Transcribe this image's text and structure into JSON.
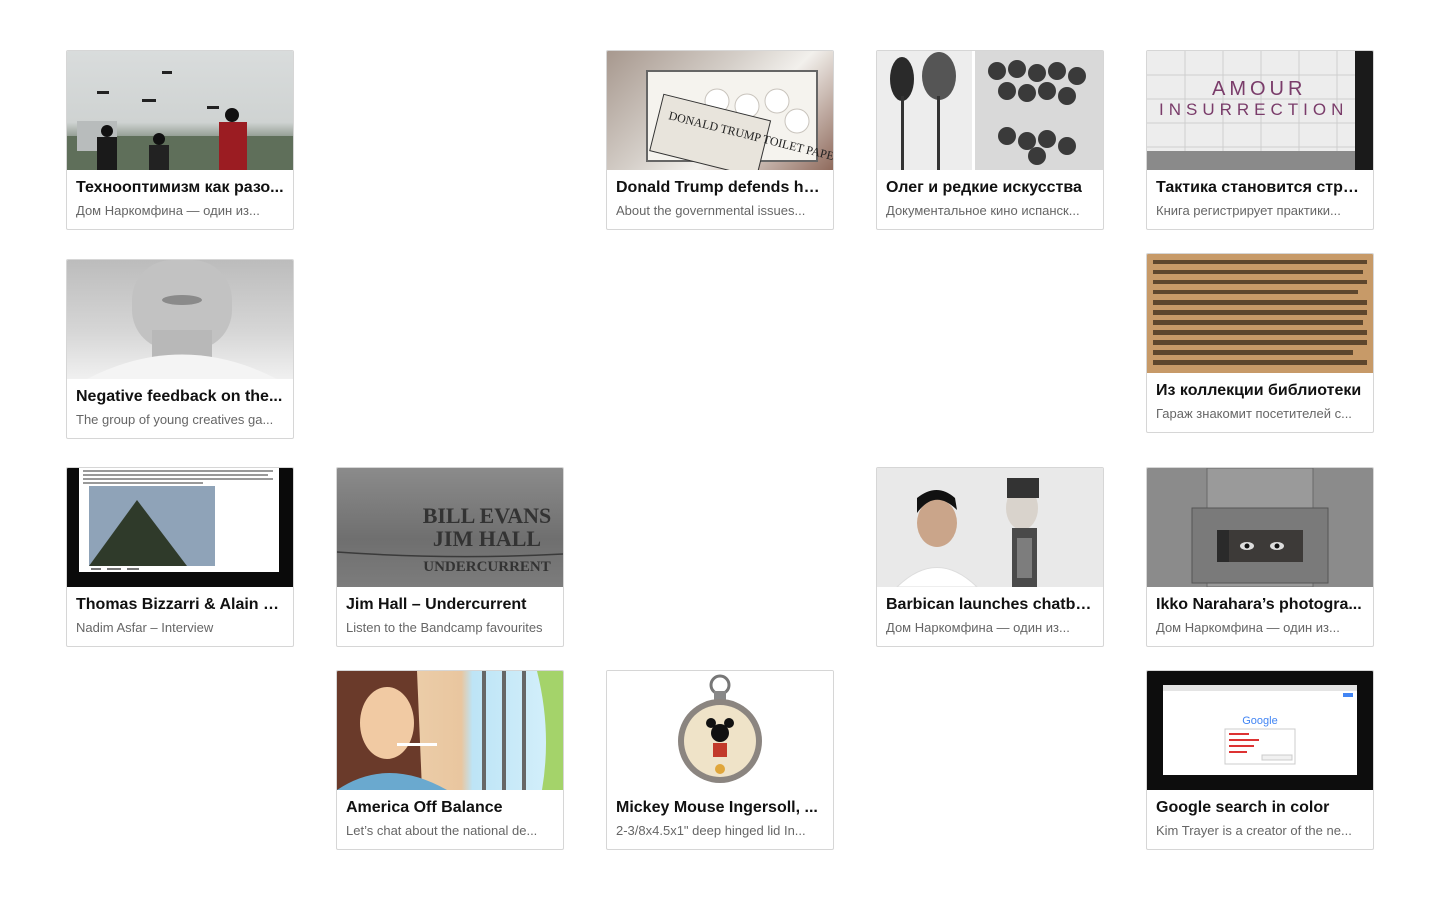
{
  "cards": [
    {
      "title": "Технооптимизм как разо...",
      "desc": "Дом Наркомфина — один из..."
    },
    {
      "title": "Donald Trump defends his...",
      "desc": "About the governmental issues..."
    },
    {
      "title": "Олег и редкие искусства",
      "desc": "Документальное кино испанск..."
    },
    {
      "title": "Тактика становится стра...",
      "desc": "Книга регистрирует практики..."
    },
    {
      "title": "Negative feedback on the...",
      "desc": "The group of young creatives ga..."
    },
    {
      "title": "Из коллекции библиотеки",
      "desc": "Гараж знакомит посетителей с..."
    },
    {
      "title": "Thomas Bizzarri & Alain R...",
      "desc": "Nadim Asfar – Interview"
    },
    {
      "title": "Jim Hall – Undercurrent",
      "desc": "Listen to the Bandcamp favourites"
    },
    {
      "title": "Barbican launches chatbo...",
      "desc": "Дом Наркомфина — один из..."
    },
    {
      "title": "Ikko Narahara’s photogra...",
      "desc": "Дом Наркомфина — один из..."
    },
    {
      "title": "America Off Balance",
      "desc": "Let’s chat about the national de..."
    },
    {
      "title": "Mickey Mouse Ingersoll, ...",
      "desc": "2-3/8x4.5x1\" deep hinged lid In..."
    },
    {
      "title": "Google search in color",
      "desc": "Kim Trayer is a creator of the ne..."
    }
  ],
  "thumb_text": {
    "trump_sign": "DONALD TRUMP TOILET PAPER",
    "wall_text_1": "AMOUR",
    "wall_text_2": "INSURRECTION",
    "vinyl_line1": "BILL EVANS",
    "vinyl_line2": "JIM HALL",
    "vinyl_line3": "UNDERCURRENT",
    "google_logo": "Google"
  }
}
